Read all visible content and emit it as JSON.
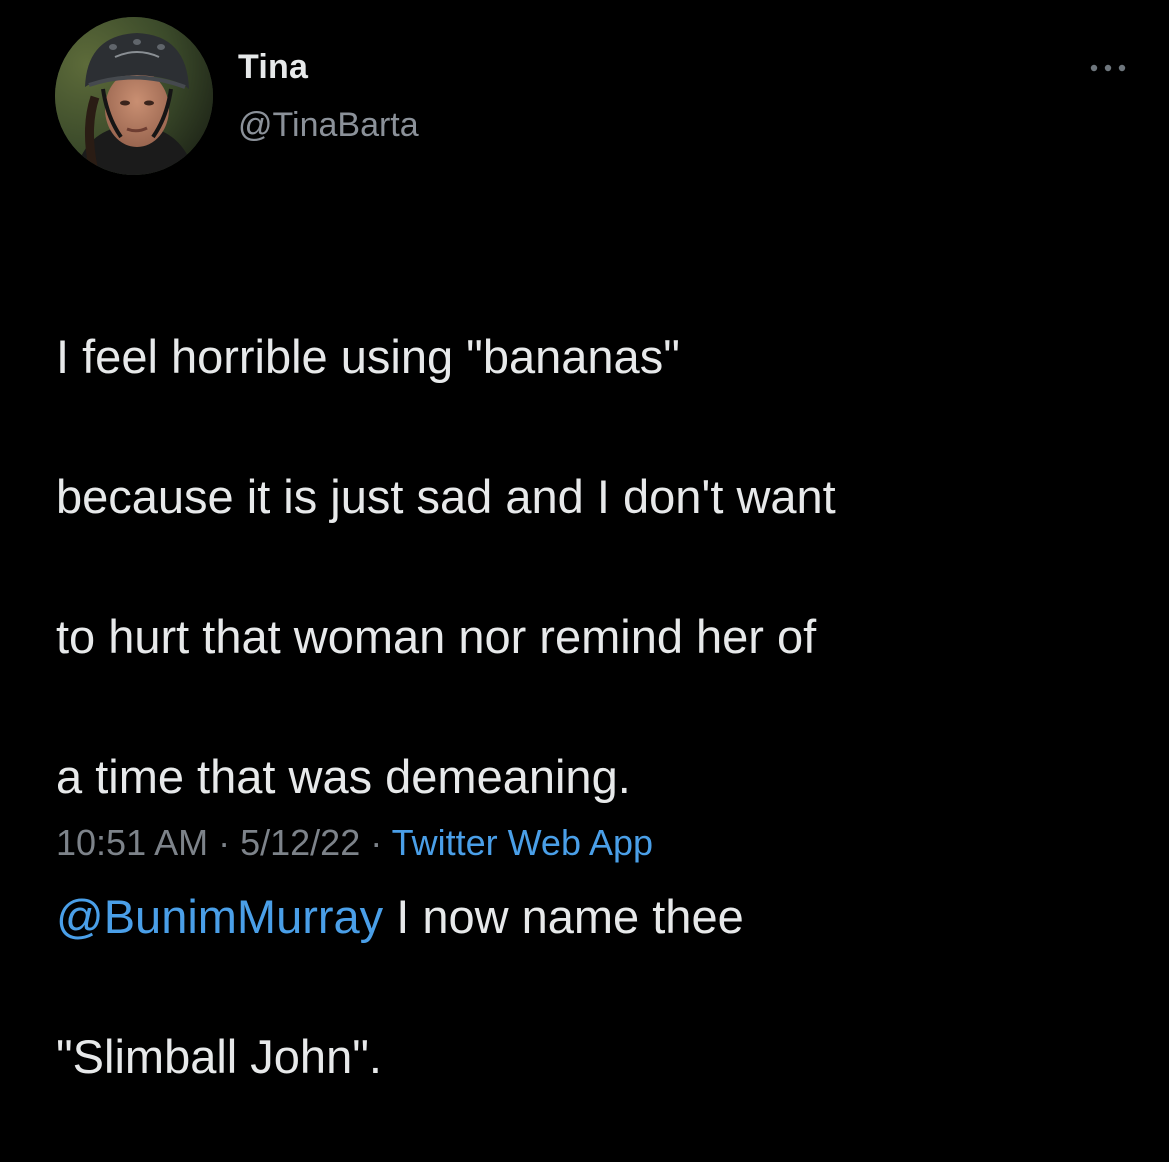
{
  "user": {
    "display_name": "Tina",
    "handle": "@TinaBarta",
    "avatar_alt": "profile-photo"
  },
  "menu": {
    "icon": "more-horizontal-icon"
  },
  "tweet": {
    "line1": "I feel horrible using \"bananas\"",
    "line2": "because it is just sad and I don't want",
    "line3": "to hurt that woman nor remind her of",
    "line4": "a time that was demeaning.",
    "mention": "@BunimMurray",
    "line5_rest": " I now name thee",
    "line6": "\"Slimball John\"."
  },
  "meta": {
    "time": "10:51 AM",
    "separator1": " · ",
    "date": "5/12/22",
    "separator2": " · ",
    "source": "Twitter Web App"
  },
  "colors": {
    "background": "#000000",
    "text": "#e7e9ea",
    "secondary": "#8b9199",
    "link": "#4a9fe8"
  }
}
